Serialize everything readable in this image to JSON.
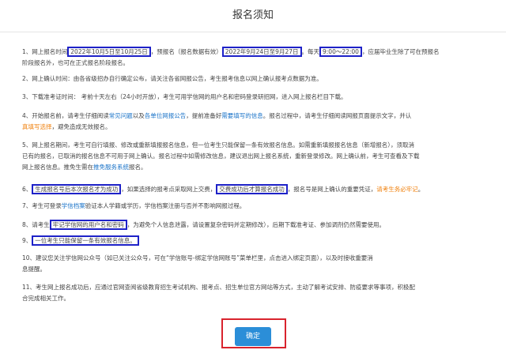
{
  "dialog": {
    "title": "报名须知"
  },
  "items": [
    {
      "lines": [
        [
          [
            "1、网上报名时间",
            ""
          ],
          [
            "2022年10月5日至10月25日",
            "box"
          ],
          [
            "，预报名（报名数据有效）",
            ""
          ],
          [
            "2022年9月24日至9月27日",
            "box"
          ],
          [
            "。每天",
            ""
          ],
          [
            "9:00～22:00",
            "box"
          ],
          [
            "，应届毕业生除了可在预报名",
            ""
          ]
        ],
        [
          [
            "阶段报名外，也可在正式报名阶段报名。",
            ""
          ]
        ]
      ]
    },
    {
      "lines": [
        [
          [
            "2、网上确认时间：由各省级招办自行确定公布，请关注各省网报公告，考生报考信息以网上确认报考点数据为准。",
            ""
          ]
        ]
      ]
    },
    {
      "lines": [
        [
          [
            "3、下载准考证时间： 考前十天左右（24小时开放），考生可用学信网的用户名和密码登录研招网，进入网上报名栏目下载。",
            ""
          ]
        ]
      ]
    },
    {
      "lines": [
        [
          [
            "4、开始报名前，请考生仔细阅读",
            ""
          ],
          [
            "常见问题",
            "blue"
          ],
          [
            "以及",
            ""
          ],
          [
            "各单位网报公告",
            "blue"
          ],
          [
            "，提前准备好",
            ""
          ],
          [
            "需要填写的信息",
            "blue"
          ],
          [
            "。报名过程中，",
            ""
          ],
          [
            "请考生仔细阅读网报页面提示文字，并认",
            ""
          ]
        ],
        [
          [
            "真填写选择",
            "orange"
          ],
          [
            "，避免造成无效报名。",
            ""
          ]
        ]
      ]
    },
    {
      "lines": [
        [
          [
            "5、网上报名期间，考生可自行填报、修改或重新填报报名信息，但一位考生只能保留一条有效报名信息。如需重新填报报名信息（新增报名），须取消",
            ""
          ]
        ],
        [
          [
            "已有的报名，已取消的报名信息不可用于网上确认。报名过程中如需修改信息，建议退出网上报名系统，重新登录修改。网上确认前，考生可查看及下载",
            ""
          ]
        ],
        [
          [
            "网上报名信息。推免生需在",
            ""
          ],
          [
            "推免服务系统",
            "blue"
          ],
          [
            "报名。",
            ""
          ]
        ]
      ]
    },
    {
      "lines": [
        [
          [
            "6、",
            ""
          ],
          [
            "生成报名号后本次报名才为成功",
            "box"
          ],
          [
            "，如果选择的报考点采取网上交费，",
            ""
          ],
          [
            "交费成功后才算报名成功",
            "box"
          ],
          [
            "，报名号是网上确认的重要凭证，",
            ""
          ],
          [
            "请考生务必牢记",
            "orange"
          ],
          [
            "。",
            ""
          ]
        ]
      ]
    },
    {
      "lines": [
        [
          [
            "7、考生可登录",
            ""
          ],
          [
            "学信档案",
            "blue"
          ],
          [
            "验证本人学籍或学历，学信档案注册与否并不影响网报过程。",
            ""
          ]
        ]
      ]
    },
    {
      "lines": [
        [
          [
            "8、请考生",
            ""
          ],
          [
            "牢记学信网的用户名和密码",
            "box"
          ],
          [
            "，为避免个人信息泄露，请设置复杂密码并定期修改），后期下载准考证、参加调剂仍然需要使用。",
            ""
          ]
        ]
      ]
    },
    {
      "lines": [
        [
          [
            "9、",
            ""
          ],
          [
            "一位考生只能保留一条有效报名信息。",
            "box"
          ]
        ]
      ]
    },
    {
      "lines": [
        [
          [
            "10、建议您关注学信网公众号（如已关注公众号，可在“学信账号-绑定学信网账号”菜单栏里，点击进入绑定页面），以及时接收重要消",
            ""
          ]
        ],
        [
          [
            "息提醒。",
            ""
          ]
        ]
      ]
    },
    {
      "lines": [
        [
          [
            "11、考生网上报名成功后，应通过官网查阅省级教育招生考试机构、报考点、招生单位官方网站等方式，主动了解考试安排、防疫要求等事项，积极配",
            ""
          ]
        ],
        [
          [
            "合完成相关工作。",
            ""
          ]
        ]
      ]
    }
  ],
  "confirm_button": {
    "label": "确定"
  }
}
